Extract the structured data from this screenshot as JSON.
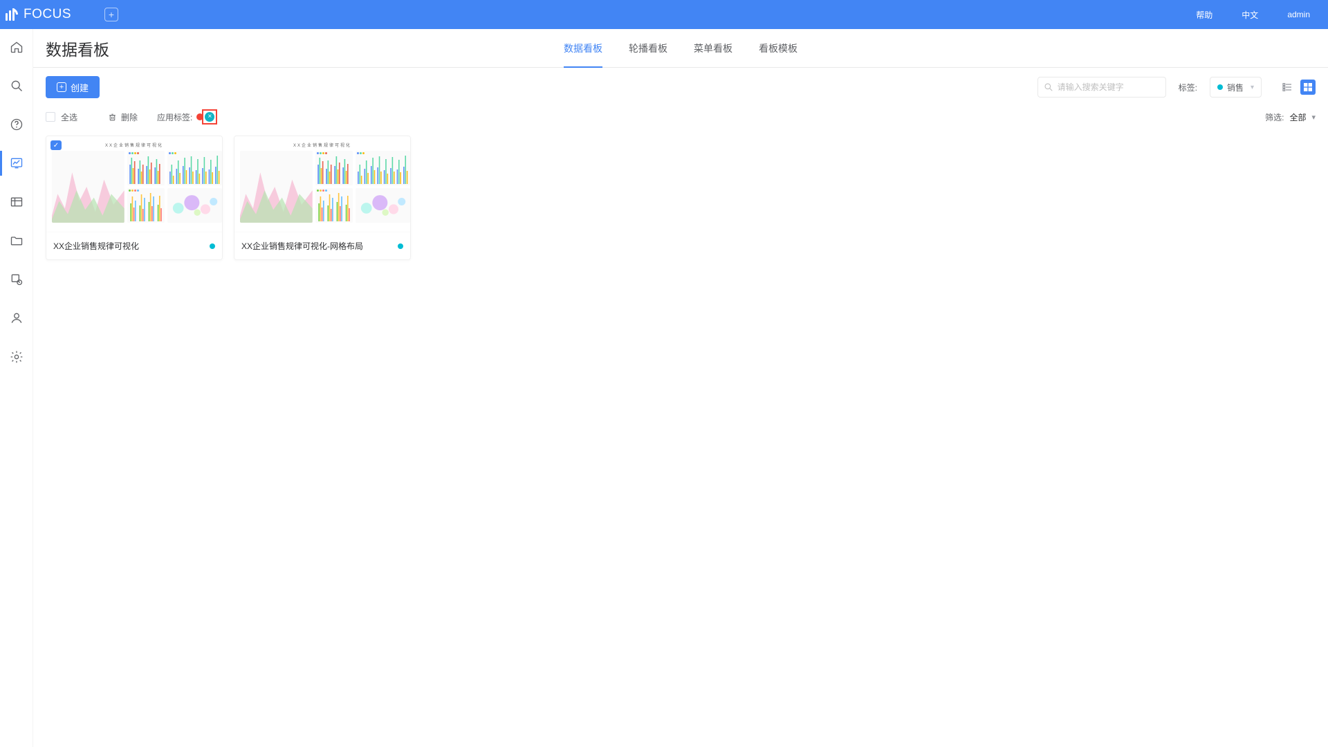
{
  "brand": "FOCUS",
  "topnav": {
    "help": "帮助",
    "lang": "中文",
    "user": "admin"
  },
  "sidebar_active_index": 3,
  "page": {
    "title": "数据看板",
    "tabs": [
      "数据看板",
      "轮播看板",
      "菜单看板",
      "看板模板"
    ],
    "active_tab": 0
  },
  "toolbar": {
    "create": "创建",
    "search_placeholder": "请输入搜索关键字",
    "tag_label": "标签:",
    "tag_value": "销售",
    "tag_color": "#00bcd4",
    "view_mode": "grid"
  },
  "actionbar": {
    "select_all": "全选",
    "delete": "删除",
    "apply_tag_label": "应用标签:",
    "filter_label": "筛选:",
    "filter_value": "全部"
  },
  "cards": [
    {
      "title": "XX企业销售规律可视化",
      "thumb_title": "XX企业销售规律可视化",
      "tag_color": "#00bcd4",
      "checked": true
    },
    {
      "title": "XX企业销售规律可视化-网格布局",
      "thumb_title": "XX企业销售规律可视化",
      "tag_color": "#00bcd4",
      "checked": false
    }
  ],
  "icons": {
    "plus": "+",
    "check": "✓",
    "x": "×",
    "search": "⌕",
    "caret": "▾",
    "caret_right": "▸"
  }
}
